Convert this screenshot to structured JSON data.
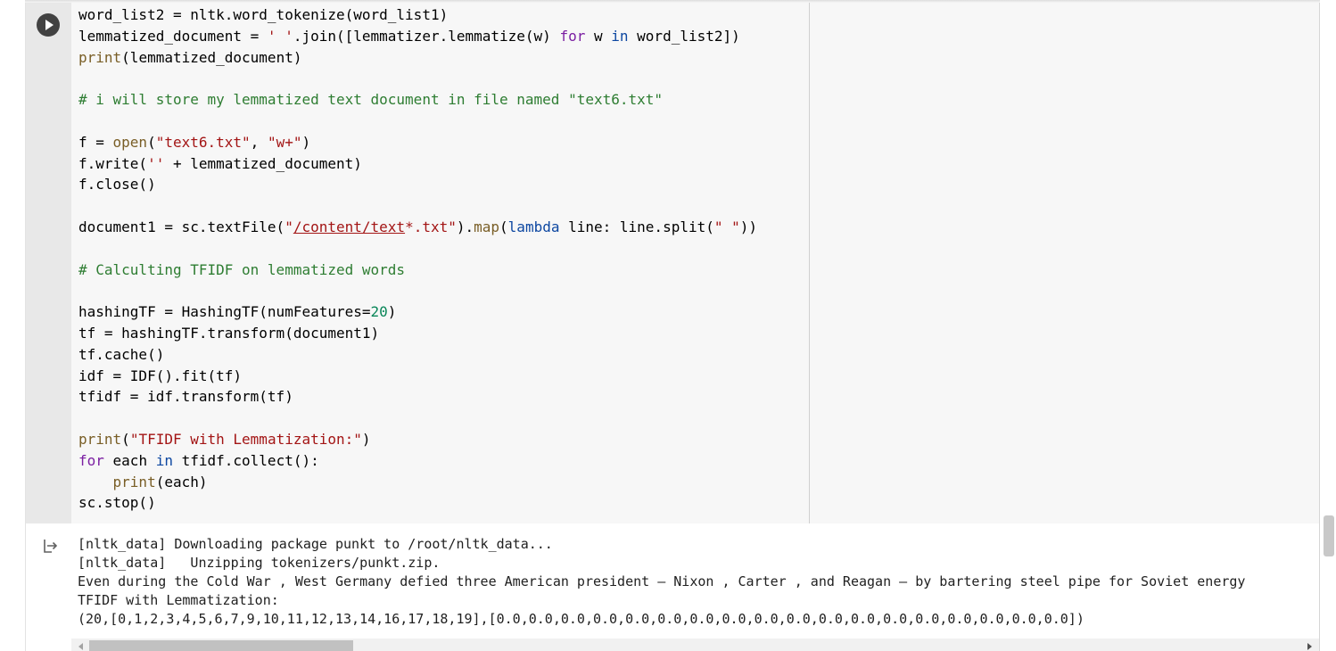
{
  "colors": {
    "keyword": "#7b1fa2",
    "keyword_blue": "#0d47a1",
    "string": "#a31515",
    "comment": "#2e7d32",
    "number": "#098658",
    "builtin": "#795e26",
    "gutter": "#e8e8e8",
    "editor_bg": "#f7f7f7"
  },
  "icons": {
    "run": "play-circle-icon",
    "output": "output-arrow-icon"
  },
  "code": {
    "l1": {
      "a": "word_list2 = nltk.word_tokenize(word_list1)"
    },
    "l2": {
      "a": "lemmatized_document = ",
      "b": "' '",
      "c": ".join([lemmatizer.lemmatize(w) ",
      "d": "for",
      "e": " w ",
      "f": "in",
      "g": " word_list2])"
    },
    "l3": {
      "a": "print",
      "b": "(lemmatized_document)"
    },
    "l5": {
      "a": "# i will store my lemmatized text document in file named \"text6.txt\""
    },
    "l7": {
      "a": "f = ",
      "b": "open",
      "c": "(",
      "d": "\"text6.txt\"",
      "e": ", ",
      "f": "\"w+\"",
      "g": ")"
    },
    "l8": {
      "a": "f.write(",
      "b": "''",
      "c": " + lemmatized_document)"
    },
    "l9": {
      "a": "f.close()"
    },
    "l11": {
      "a": "document1 = sc.textFile(",
      "b": "\"",
      "c": "/content/text",
      "d": "*.txt\"",
      "e": ").",
      "f": "map",
      "g": "(",
      "h": "lambda",
      "i": " line: line.split(",
      "j": "\" \"",
      "k": "))"
    },
    "l13": {
      "a": "# Calculting TFIDF on lemmatized words"
    },
    "l15": {
      "a": "hashingTF = HashingTF(numFeatures=",
      "b": "20",
      "c": ")"
    },
    "l16": {
      "a": "tf = hashingTF.transform(document1)"
    },
    "l17": {
      "a": "tf.cache()"
    },
    "l18": {
      "a": "idf = IDF().fit(tf)"
    },
    "l19": {
      "a": "tfidf = idf.transform(tf)"
    },
    "l21": {
      "a": "print",
      "b": "(",
      "c": "\"TFIDF with Lemmatization:\"",
      "d": ")"
    },
    "l22": {
      "a": "for",
      "b": " each ",
      "c": "in",
      "d": " tfidf.collect():"
    },
    "l23": {
      "a": "    ",
      "b": "print",
      "c": "(each)"
    },
    "l24": {
      "a": "sc.stop()"
    }
  },
  "output": {
    "lines": [
      "[nltk_data] Downloading package punkt to /root/nltk_data...",
      "[nltk_data]   Unzipping tokenizers/punkt.zip.",
      "Even during the Cold War , West Germany defied three American president – Nixon , Carter , and Reagan – by bartering steel pipe for Soviet energy",
      "TFIDF with Lemmatization:",
      "(20,[0,1,2,3,4,5,6,7,9,10,11,12,13,14,16,17,18,19],[0.0,0.0,0.0,0.0,0.0,0.0,0.0,0.0,0.0,0.0,0.0,0.0,0.0,0.0,0.0,0.0,0.0,0.0])"
    ]
  },
  "scroll": {
    "horizontal_fraction_visible": 0.21,
    "horizontal_position": 0.0
  }
}
